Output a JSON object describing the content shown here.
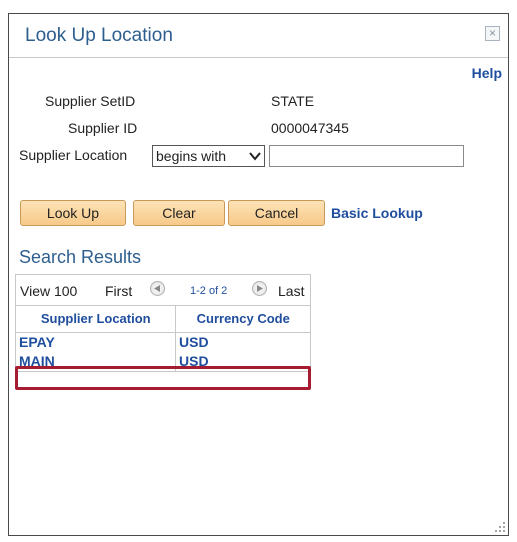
{
  "dialog": {
    "title": "Look Up Location",
    "close_symbol": "×",
    "help_label": "Help"
  },
  "criteria": {
    "setid_label": "Supplier SetID",
    "setid_value": "STATE",
    "supplier_id_label": "Supplier ID",
    "supplier_id_value": "0000047345",
    "location_label": "Supplier Location",
    "location_operator": "begins with",
    "location_value": ""
  },
  "buttons": {
    "look_up": "Look Up",
    "clear": "Clear",
    "cancel": "Cancel",
    "basic_lookup": "Basic Lookup"
  },
  "results": {
    "title": "Search Results",
    "view_label": "View 100",
    "first_label": "First",
    "page_info": "1-2 of 2",
    "last_label": "Last",
    "columns": [
      "Supplier Location",
      "Currency Code"
    ],
    "rows": [
      [
        "EPAY",
        "USD"
      ],
      [
        "MAIN",
        "USD"
      ]
    ]
  },
  "colors": {
    "accent": "#2d5e8e",
    "link": "#1f4e9e",
    "highlight": "#a61b2f"
  },
  "icons": [
    "close-icon",
    "chevron-down-icon",
    "arrow-left-icon",
    "arrow-right-icon",
    "resize-grip-icon"
  ]
}
